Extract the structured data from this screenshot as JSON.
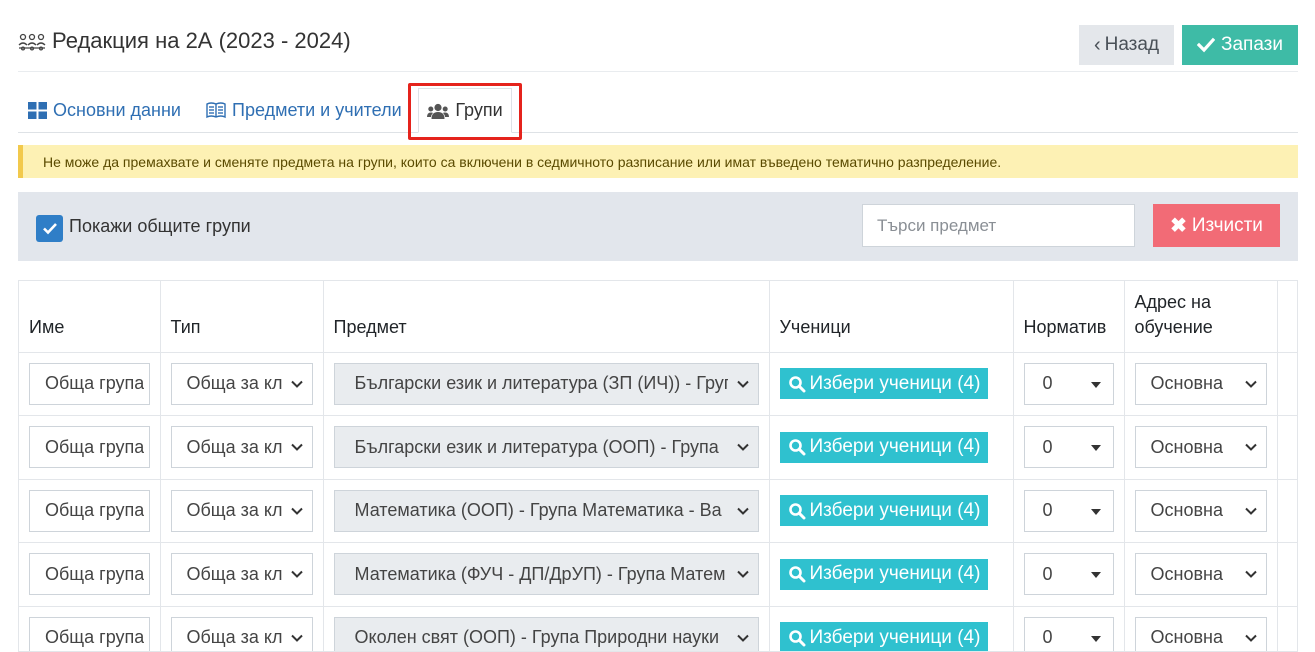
{
  "header": {
    "title": "Редакция на 2А (2023 - 2024)",
    "back_label": "Назад",
    "save_label": "Запази"
  },
  "tabs": [
    {
      "label": "Основни данни",
      "icon": "grid-icon"
    },
    {
      "label": "Предмети и учители",
      "icon": "book-icon"
    },
    {
      "label": "Групи",
      "icon": "users-icon",
      "active": true
    }
  ],
  "alert": {
    "text": "Не може да премахвате и сменяте предмета на групи, които са включени в седмичното разписание или имат въведено тематично разпределение."
  },
  "filter": {
    "show_common_label": "Покажи общите групи",
    "show_common_checked": true,
    "search_placeholder": "Търси предмет",
    "clear_label": "Изчисти"
  },
  "table": {
    "headers": {
      "name": "Име",
      "type": "Тип",
      "subject": "Предмет",
      "students": "Ученици",
      "norm": "Норматив",
      "address": "Адрес на обучение"
    },
    "rows": [
      {
        "name": "Обща група",
        "type": "Обща за класа",
        "subject": "Български език и литература (ЗП (ИЧ)) - Група",
        "students_btn": "Избери ученици (4)",
        "norm": "0",
        "address": "Основна"
      },
      {
        "name": "Обща група",
        "type": "Обща за класа",
        "subject": "Български език и литература (ООП) - Група",
        "students_btn": "Избери ученици (4)",
        "norm": "0",
        "address": "Основна"
      },
      {
        "name": "Обща група",
        "type": "Обща за класа",
        "subject": "Математика (ООП) - Група Математика - Ва",
        "students_btn": "Избери ученици (4)",
        "norm": "0",
        "address": "Основна"
      },
      {
        "name": "Обща група",
        "type": "Обща за класа",
        "subject": "Математика (ФУЧ - ДП/ДрУП) - Група Матем",
        "students_btn": "Избери ученици (4)",
        "norm": "0",
        "address": "Основна"
      },
      {
        "name": "Обща група",
        "type": "Обща за класа",
        "subject": "Околен свят (ООП) - Група Природни науки",
        "students_btn": "Избери ученици (4)",
        "norm": "0",
        "address": "Основна"
      }
    ]
  },
  "colors": {
    "primary": "#2f6fb3",
    "save": "#3ebba6",
    "clear": "#f26b76",
    "students": "#2fc1cf",
    "alert_bg": "#fdf1b4",
    "highlight": "#e5231c"
  }
}
